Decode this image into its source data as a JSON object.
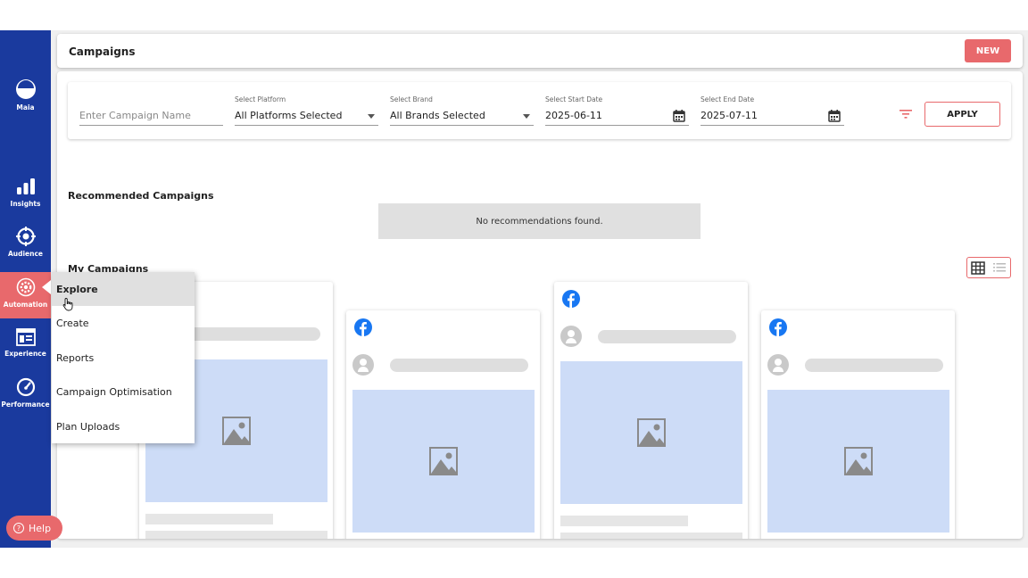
{
  "app": {
    "brand_label": "Maia"
  },
  "sidebar": {
    "items": [
      {
        "label": "Insights",
        "icon": "bar-chart-icon"
      },
      {
        "label": "Audience",
        "icon": "target-icon"
      },
      {
        "label": "Automation",
        "icon": "gear-icon",
        "active": true
      },
      {
        "label": "Experience",
        "icon": "browser-window-icon"
      },
      {
        "label": "Performance",
        "icon": "gauge-icon"
      }
    ],
    "help_label": "Help"
  },
  "header": {
    "title": "Campaigns",
    "new_label": "NEW"
  },
  "filters": {
    "campaign_name": {
      "placeholder": "Enter Campaign Name"
    },
    "platform": {
      "label": "Select Platform",
      "value": "All Platforms Selected"
    },
    "brand": {
      "label": "Select Brand",
      "value": "All Brands Selected"
    },
    "start_date": {
      "label": "Select Start Date",
      "value": "2025-06-11"
    },
    "end_date": {
      "label": "Select End Date",
      "value": "2025-07-11"
    },
    "apply_label": "APPLY"
  },
  "recommended": {
    "title": "Recommended Campaigns",
    "empty_text": "No recommendations found."
  },
  "my_campaigns": {
    "title": "My Campaigns"
  },
  "automation_menu": {
    "items": [
      {
        "label": "Explore",
        "active": true
      },
      {
        "label": "Create"
      },
      {
        "label": "Reports"
      },
      {
        "label": "Campaign Optimisation"
      },
      {
        "label": "Plan Uploads"
      }
    ]
  },
  "colors": {
    "sidebar": "#1a3a9e",
    "accent": "#e8696c",
    "facebook": "#1877f2",
    "image_placeholder": "#cddcf7"
  }
}
